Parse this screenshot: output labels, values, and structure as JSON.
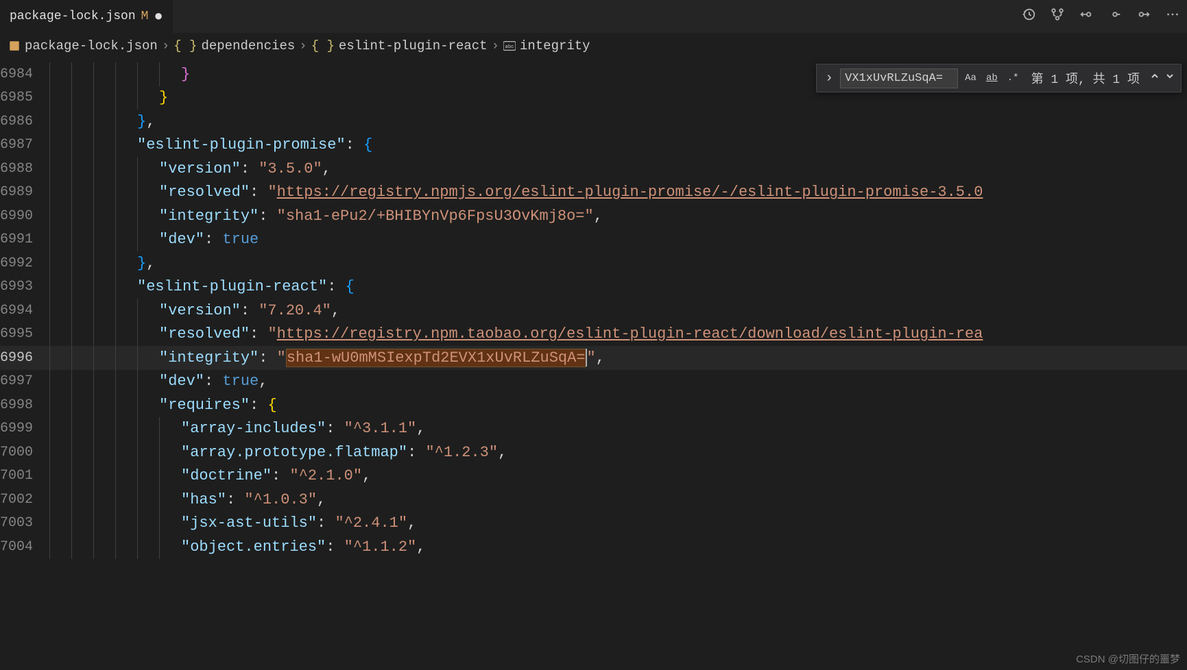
{
  "tab": {
    "name": "package-lock.json",
    "modified": "M"
  },
  "breadcrumb": {
    "file": "package-lock.json",
    "path1": "dependencies",
    "path2": "eslint-plugin-react",
    "path3": "integrity"
  },
  "find": {
    "query": "VX1xUvRLZuSqA=",
    "count": "第 1 项, 共 1 项",
    "opt_case": "Aa",
    "opt_word": "ab",
    "opt_regex": ".*"
  },
  "lineNumbers": [
    "6984",
    "6985",
    "6986",
    "6987",
    "6988",
    "6989",
    "6990",
    "6991",
    "6992",
    "6993",
    "6994",
    "6995",
    "6996",
    "6997",
    "6998",
    "6999",
    "7000",
    "7001",
    "7002",
    "7003",
    "7004"
  ],
  "code": {
    "l6987_key": "\"eslint-plugin-promise\"",
    "l6988_key": "\"version\"",
    "l6988_val": "\"3.5.0\"",
    "l6989_key": "\"resolved\"",
    "l6989_url": "https://registry.npmjs.org/eslint-plugin-promise/-/eslint-plugin-promise-3.5.0",
    "l6990_key": "\"integrity\"",
    "l6990_val": "\"sha1-ePu2/+BHIBYnVp6FpsU3OvKmj8o=\"",
    "l6991_key": "\"dev\"",
    "l6991_val": "true",
    "l6993_key": "\"eslint-plugin-react\"",
    "l6994_key": "\"version\"",
    "l6994_val": "\"7.20.4\"",
    "l6995_key": "\"resolved\"",
    "l6995_url": "https://registry.npm.taobao.org/eslint-plugin-react/download/eslint-plugin-rea",
    "l6996_key": "\"integrity\"",
    "l6996_hl": "sha1-wU0mMSIexpTd2EVX1xUvRLZuSqA=",
    "l6997_key": "\"dev\"",
    "l6997_val": "true",
    "l6998_key": "\"requires\"",
    "l6999_key": "\"array-includes\"",
    "l6999_val": "\"^3.1.1\"",
    "l7000_key": "\"array.prototype.flatmap\"",
    "l7000_val": "\"^1.2.3\"",
    "l7001_key": "\"doctrine\"",
    "l7001_val": "\"^2.1.0\"",
    "l7002_key": "\"has\"",
    "l7002_val": "\"^1.0.3\"",
    "l7003_key": "\"jsx-ast-utils\"",
    "l7003_val": "\"^2.4.1\"",
    "l7004_key": "\"object.entries\"",
    "l7004_val": "\"^1.1.2\""
  },
  "watermark": "CSDN @切图仔的噩梦"
}
